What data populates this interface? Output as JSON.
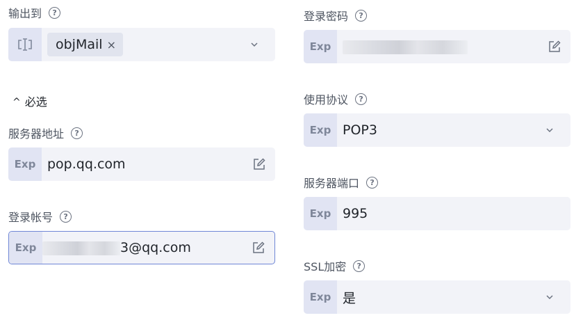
{
  "left": {
    "output": {
      "label": "输出到",
      "tag": "objMail",
      "tag_close": "×"
    },
    "required_section": {
      "caret": "^",
      "label": "必选"
    },
    "server_address": {
      "label": "服务器地址",
      "prefix": "Exp",
      "value": "pop.qq.com"
    },
    "login_account": {
      "label": "登录帐号",
      "prefix": "Exp",
      "value_suffix": "3@qq.com"
    }
  },
  "right": {
    "login_password": {
      "label": "登录密码",
      "prefix": "Exp"
    },
    "protocol": {
      "label": "使用协议",
      "prefix": "Exp",
      "value": "POP3"
    },
    "server_port": {
      "label": "服务器端口",
      "prefix": "Exp",
      "value": "995"
    },
    "ssl": {
      "label": "SSL加密",
      "prefix": "Exp",
      "value": "是"
    }
  },
  "help_glyph": "?",
  "icons": {
    "output_target": "variable-bracket-icon",
    "edit": "edit-pencil-icon",
    "dropdown": "chevron-down-icon",
    "help": "question-circle-icon"
  },
  "colors": {
    "field_bg": "#f2f3f8",
    "prefix_bg": "#e1e4f3",
    "focus_border": "#6f86d6",
    "label_text": "#4e5561"
  }
}
